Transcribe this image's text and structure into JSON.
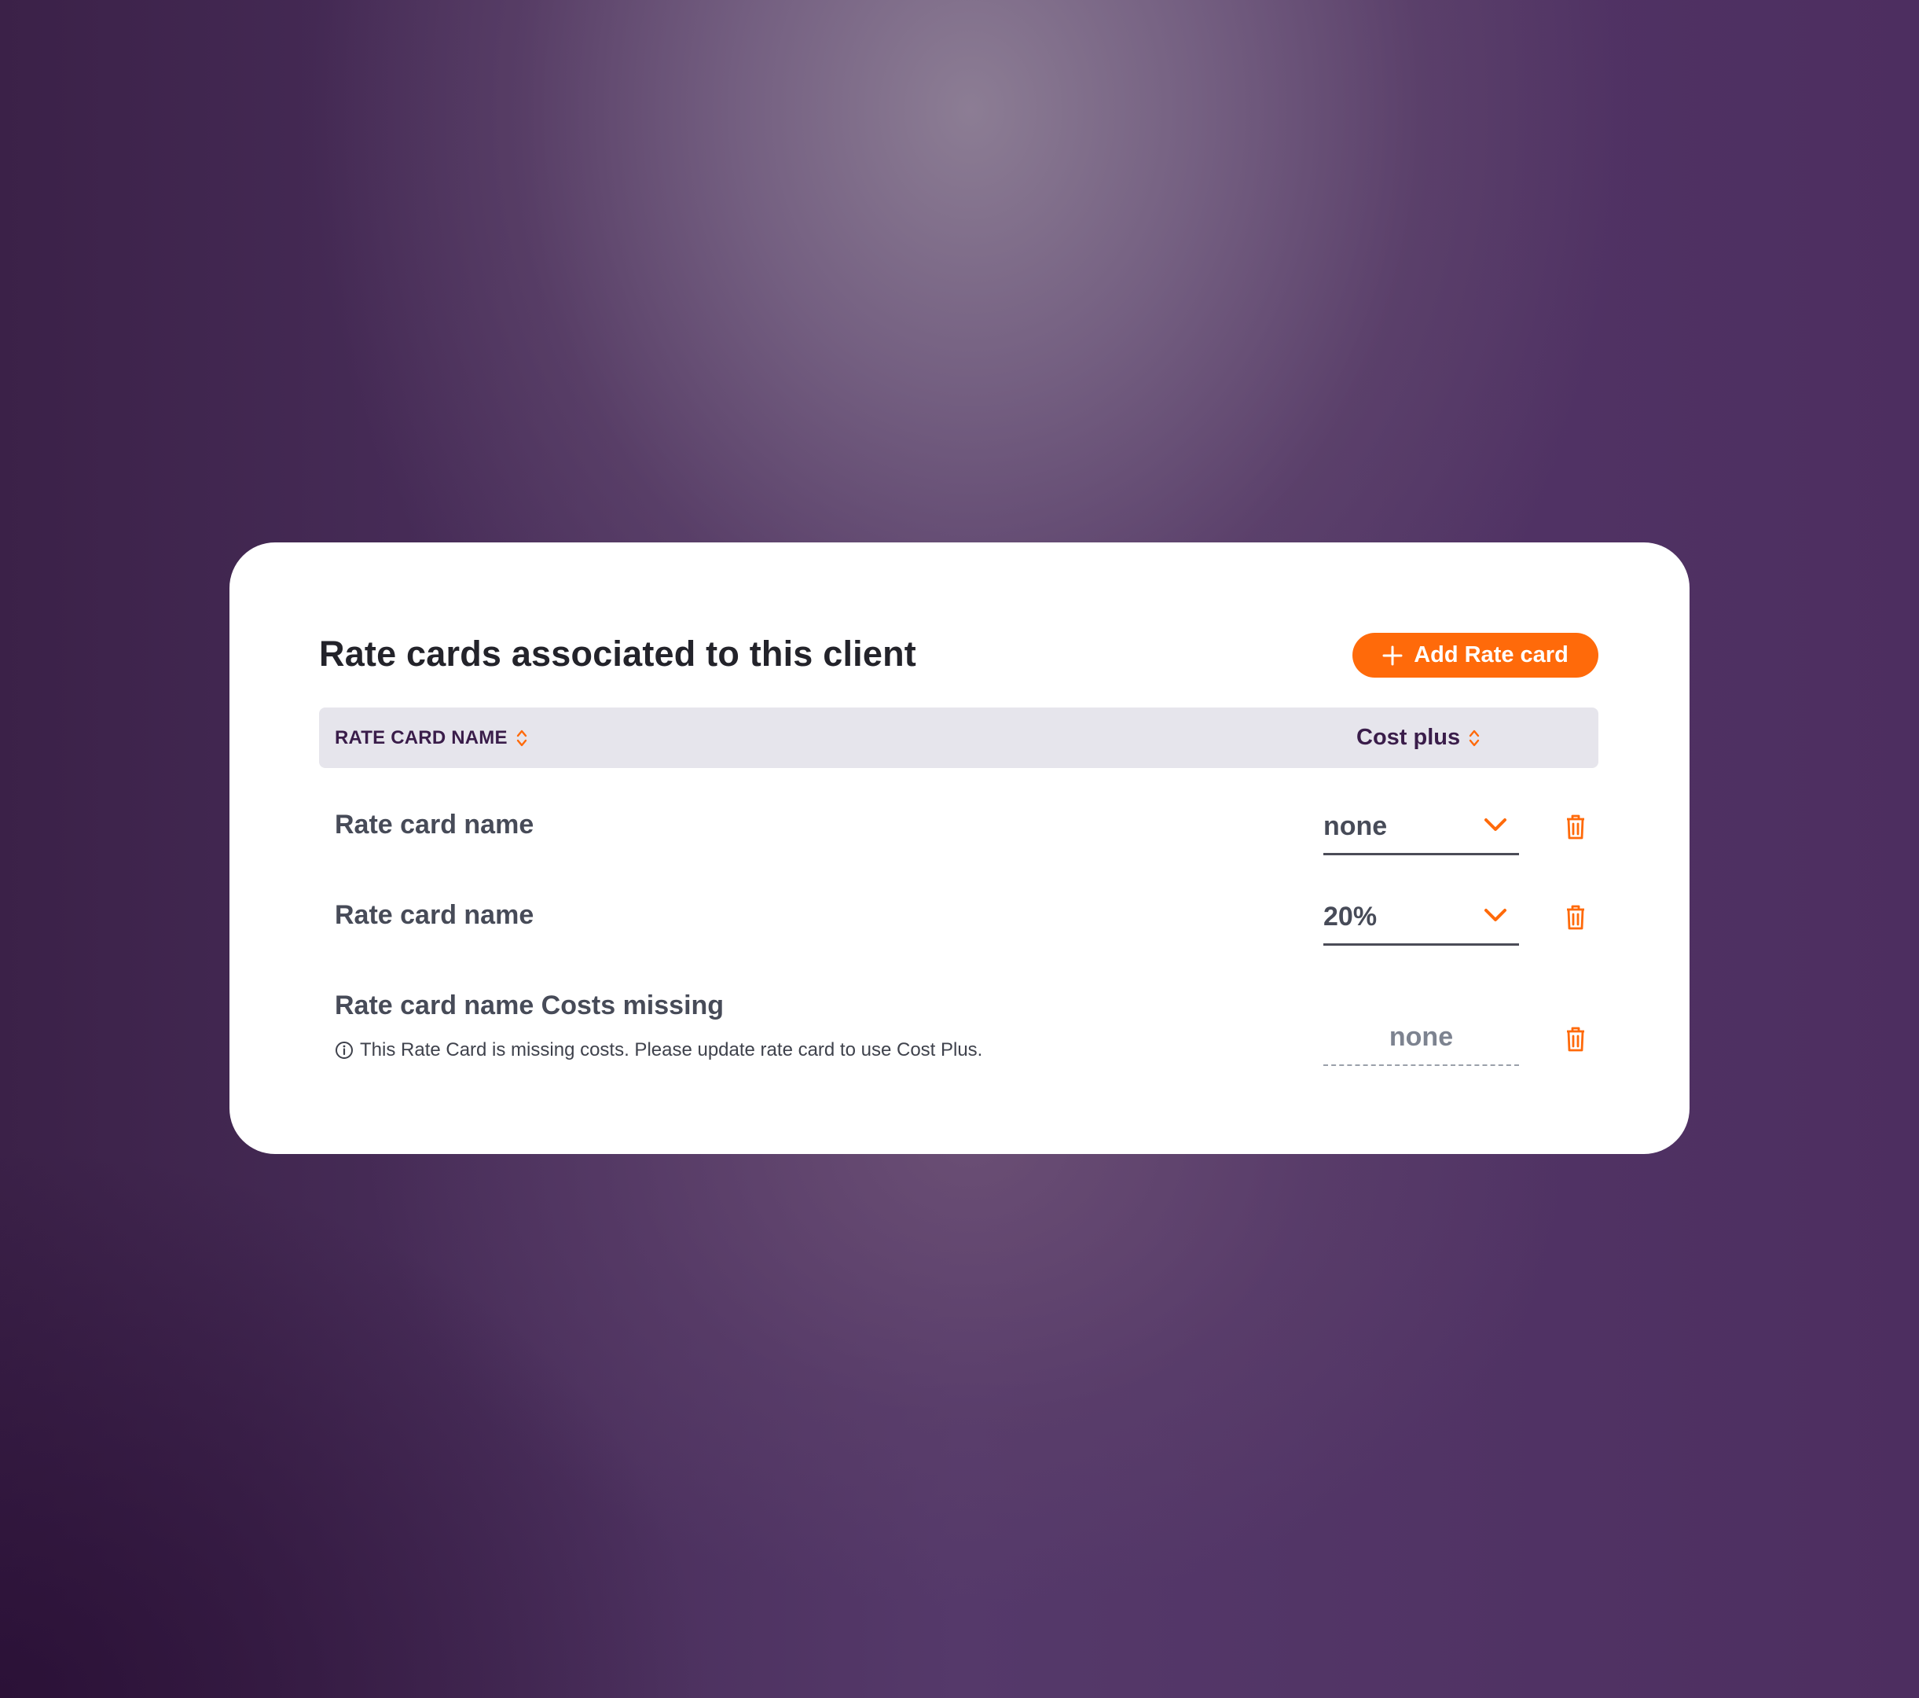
{
  "panel": {
    "title": "Rate cards associated to this client",
    "add_button_label": "Add Rate card"
  },
  "table": {
    "columns": {
      "name_header": "RATE CARD NAME",
      "cost_header": "Cost plus"
    },
    "rows": [
      {
        "name": "Rate card name",
        "cost_plus": "none",
        "editable": true
      },
      {
        "name": "Rate card name",
        "cost_plus": "20%",
        "editable": true
      },
      {
        "name": "Rate card name Costs missing",
        "cost_plus": "none",
        "editable": false,
        "warning": "This Rate Card is missing costs. Please update rate card to use Cost Plus."
      }
    ]
  },
  "icons": {
    "add": "plus-icon",
    "sort": "sort-icon",
    "dropdown": "chevron-down-icon",
    "delete": "trash-icon",
    "info": "info-icon"
  },
  "colors": {
    "accent": "#ff6a0a",
    "header_bg": "#e6e5ec",
    "header_text": "#3a1d4a",
    "body_text": "#474b58",
    "title_text": "#23232a"
  }
}
